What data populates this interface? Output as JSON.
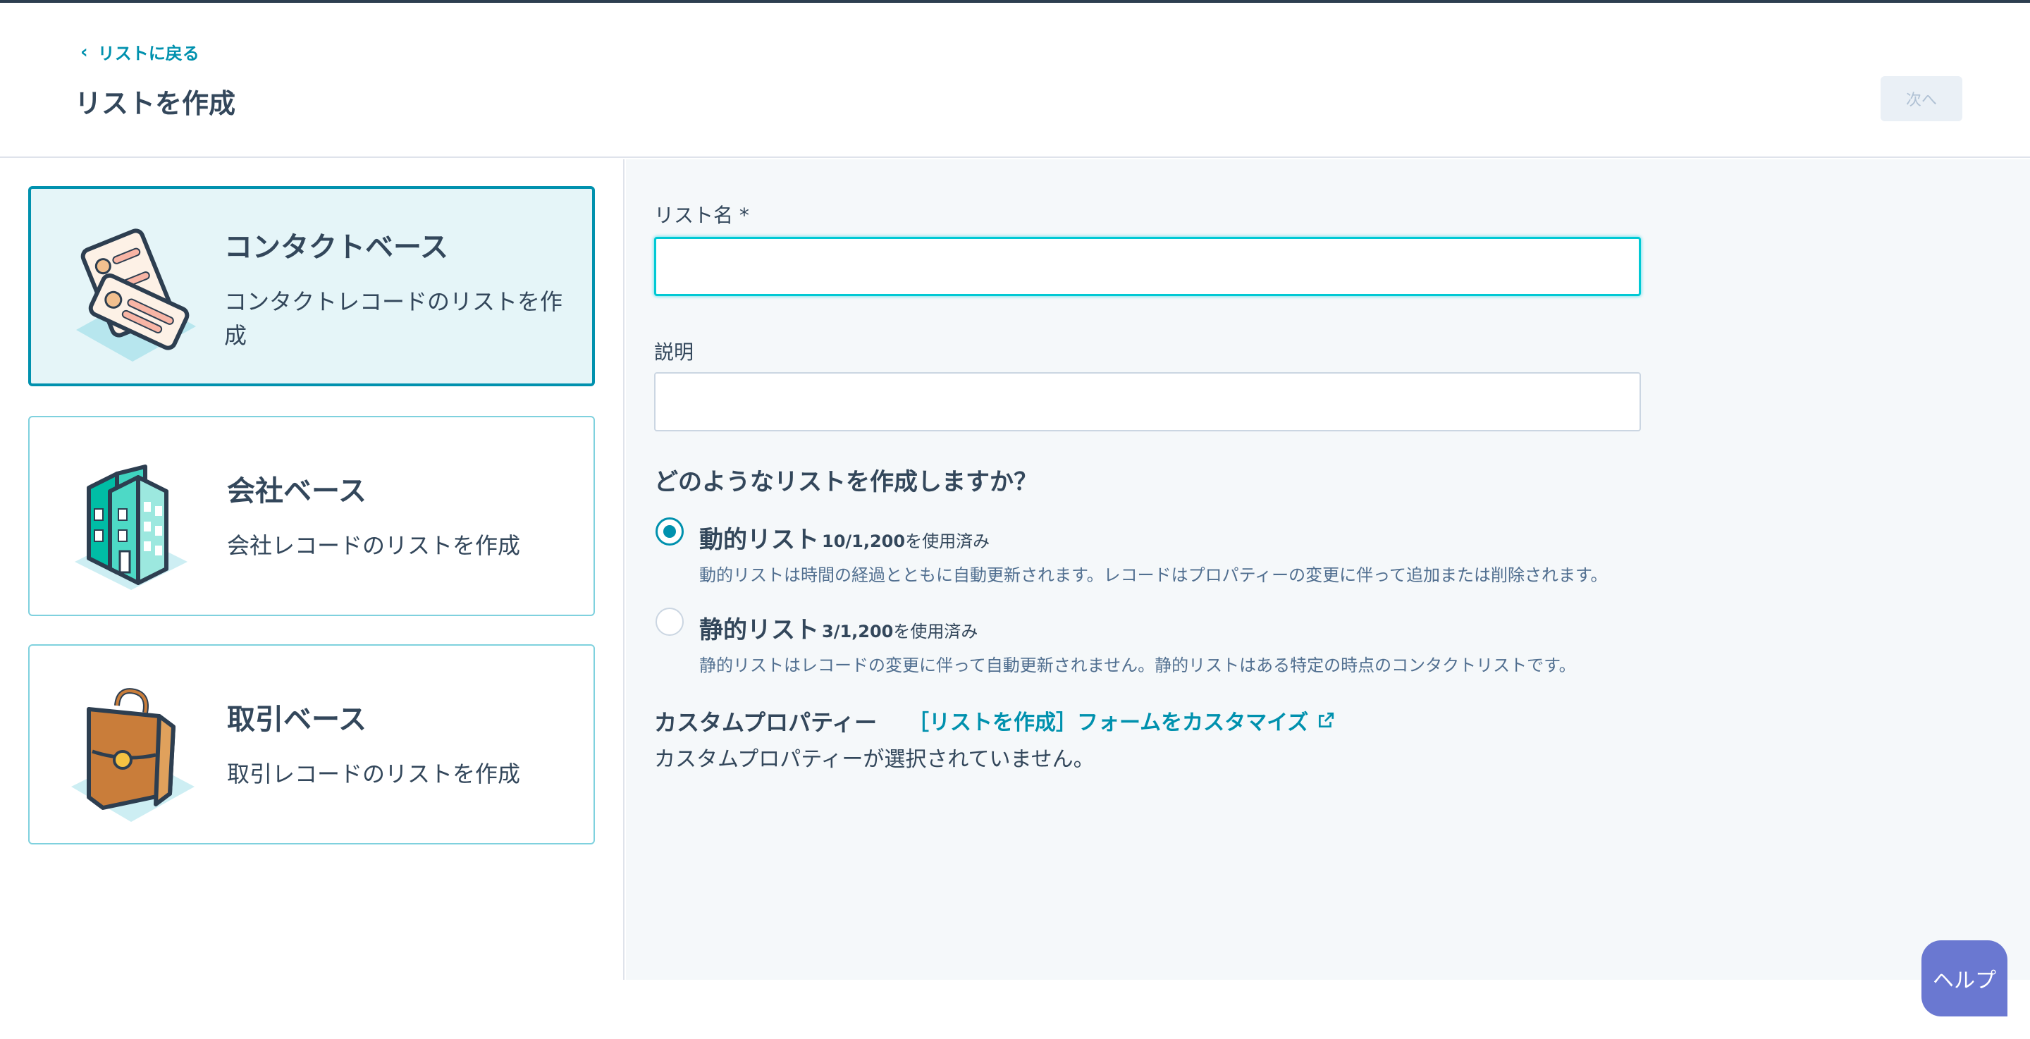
{
  "header": {
    "back_label": "リストに戻る",
    "title": "リストを作成",
    "next_label": "次へ"
  },
  "cards": [
    {
      "title": "コンタクトベース",
      "description": "コンタクトレコードのリストを作成",
      "icon": "contact-cards-icon",
      "selected": true
    },
    {
      "title": "会社ベース",
      "description": "会社レコードのリストを作成",
      "icon": "company-building-icon",
      "selected": false
    },
    {
      "title": "取引ベース",
      "description": "取引レコードのリストを作成",
      "icon": "deal-briefcase-icon",
      "selected": false
    }
  ],
  "form": {
    "name_label": "リスト名 *",
    "name_value": "",
    "description_label": "説明",
    "description_value": "",
    "question": "どのようなリストを作成しますか？",
    "options": [
      {
        "name": "動的リスト",
        "usage_count": "10/1,200",
        "usage_suffix": "を使用済み",
        "description": "動的リストは時間の経過とともに自動更新されます。レコードはプロパティーの変更に伴って追加または削除されます。",
        "checked": true
      },
      {
        "name": "静的リスト",
        "usage_count": "3/1,200",
        "usage_suffix": "を使用済み",
        "description": "静的リストはレコードの変更に伴って自動更新されません。静的リストはある特定の時点のコンタクトリストです。",
        "checked": false
      }
    ],
    "custom_title": "カスタムプロパティー",
    "custom_link": "［リストを作成］フォームをカスタマイズ",
    "custom_empty": "カスタムプロパティーが選択されていません。"
  },
  "help_label": "ヘルプ",
  "colors": {
    "accent": "#0091ae",
    "selected_bg": "#e5f5f8",
    "help": "#6a78d1",
    "focus": "#00c9d4"
  }
}
